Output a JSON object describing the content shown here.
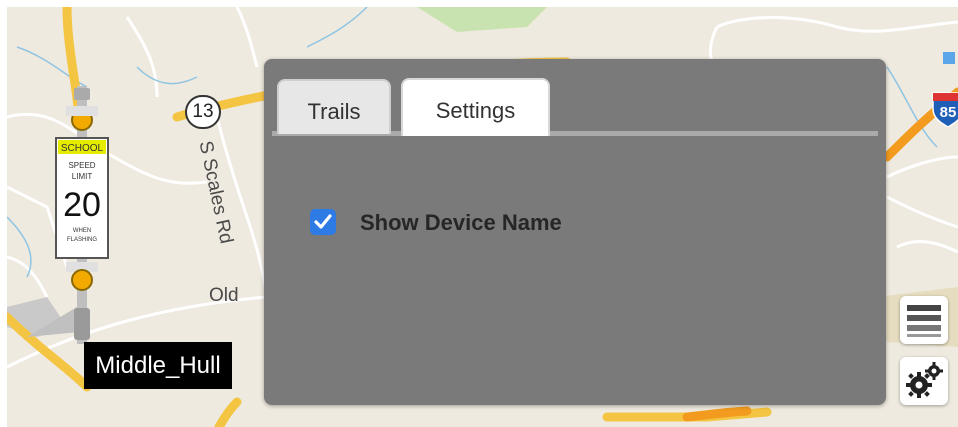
{
  "map": {
    "route_shield": "13",
    "interstate_shield": "85",
    "street_label_1": "S Scales Rd",
    "street_label_2": "Old ",
    "colors": {
      "land": "#efeadf",
      "major_road": "#f4c542",
      "highway": "#f29b1f",
      "water": "#9ad1ec",
      "park": "#c9e3b0"
    }
  },
  "device": {
    "name": "Middle_Hull",
    "sign_text": {
      "school": "SCHOOL",
      "speed": "SPEED",
      "limit": "LIMIT",
      "value": "20",
      "when": "WHEN",
      "flashing": "FLASHING"
    }
  },
  "panel": {
    "tabs": [
      {
        "label": "Trails",
        "active": false
      },
      {
        "label": "Settings",
        "active": true
      }
    ],
    "options": [
      {
        "label": "Show Device Name",
        "checked": true
      }
    ]
  },
  "controls": {
    "layers_icon": "layers-icon",
    "settings_icon": "gears-icon"
  }
}
